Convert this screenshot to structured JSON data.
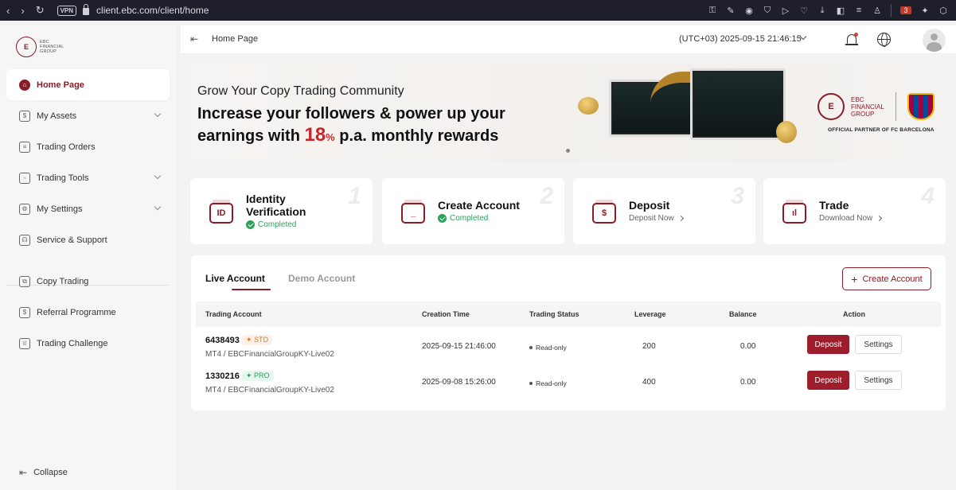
{
  "browser": {
    "url": "client.ebc.com/client/home",
    "vpn": "VPN",
    "ext_count": "3"
  },
  "brand": {
    "logo_text": [
      "EBC",
      "FINANCIAL",
      "GROUP"
    ],
    "accent": "#8a1c27"
  },
  "sidebar": {
    "items": [
      {
        "label": "Home Page",
        "icon": "home-icon",
        "active": true
      },
      {
        "label": "My Assets",
        "icon": "wallet-icon",
        "expandable": true
      },
      {
        "label": "Trading Orders",
        "icon": "orders-icon"
      },
      {
        "label": "Trading Tools",
        "icon": "tools-icon",
        "expandable": true
      },
      {
        "label": "My Settings",
        "icon": "settings-icon",
        "expandable": true
      },
      {
        "label": "Service & Support",
        "icon": "headset-icon"
      },
      {
        "label": "Copy Trading",
        "icon": "copy-icon"
      },
      {
        "label": "Referral Programme",
        "icon": "referral-icon"
      },
      {
        "label": "Trading Challenge",
        "icon": "trophy-icon"
      }
    ],
    "collapse_label": "Collapse"
  },
  "header": {
    "title": "Home Page",
    "timezone": "(UTC+03)  2025-09-15 21:46:15"
  },
  "banner": {
    "subtitle": "Grow Your Copy Trading Community",
    "line1": "Increase your followers & power up your",
    "line2_pre": "earnings with ",
    "pct": "18",
    "pct_sym": "%",
    "line2_post": " p.a. monthly rewards",
    "brand_lines": [
      "EBC",
      "FINANCIAL",
      "GROUP"
    ],
    "partner": "OFFICIAL PARTNER OF FC BARCELONA"
  },
  "steps": [
    {
      "num": "1",
      "title_1": "Identity",
      "title_2": "Verification",
      "status": "Completed"
    },
    {
      "num": "2",
      "title": "Create Account",
      "status": "Completed"
    },
    {
      "num": "3",
      "title": "Deposit",
      "link": "Deposit Now"
    },
    {
      "num": "4",
      "title": "Trade",
      "link": "Download Now"
    }
  ],
  "accounts": {
    "tabs": [
      "Live Account",
      "Demo Account"
    ],
    "create_label": "Create Account",
    "columns": [
      "Trading Account",
      "Creation Time",
      "Trading Status",
      "Leverage",
      "Balance",
      "Action"
    ],
    "rows": [
      {
        "number": "6438493",
        "tag": "STD",
        "server": "MT4 / EBCFinancialGroupKY-Live02",
        "created": "2025-09-15 21:46:00",
        "status": "Read-only",
        "leverage": "200",
        "balance": "0.00",
        "deposit": "Deposit",
        "settings": "Settings"
      },
      {
        "number": "1330216",
        "tag": "PRO",
        "server": "MT4 / EBCFinancialGroupKY-Live02",
        "created": "2025-09-08 15:26:00",
        "status": "Read-only",
        "leverage": "400",
        "balance": "0.00",
        "deposit": "Deposit",
        "settings": "Settings"
      }
    ]
  }
}
